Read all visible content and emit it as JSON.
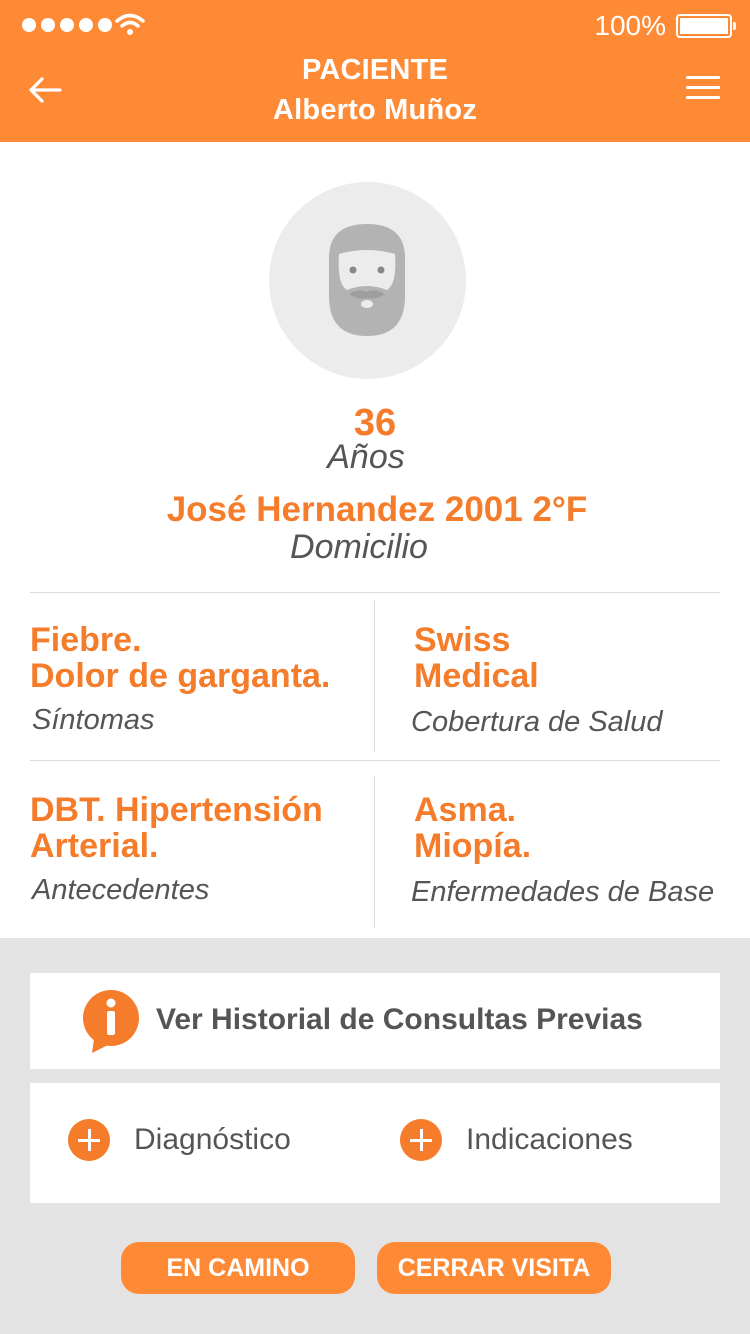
{
  "status_bar": {
    "battery": "100%",
    "signal_dots": 5
  },
  "header": {
    "title": "PACIENTE",
    "patient_name": "Alberto Muñoz"
  },
  "profile": {
    "age": "36",
    "age_label": "Años",
    "address": "José Hernandez 2001 2°F",
    "address_label": "Domicilio"
  },
  "details": {
    "sintomas": {
      "value": "Fiebre.\nDolor de garganta.",
      "label": "Síntomas"
    },
    "cobertura": {
      "value": "Swiss\nMedical",
      "label": "Cobertura de Salud"
    },
    "antecedentes": {
      "value": "DBT. Hipertensión\nArterial.",
      "label": "Antecedentes"
    },
    "enfermedades": {
      "value": "Asma.\nMiopía.",
      "label": "Enfermedades de Base"
    }
  },
  "actions": {
    "historial": "Ver Historial de Consultas Previas",
    "diagnostico": "Diagnóstico",
    "indicaciones": "Indicaciones"
  },
  "buttons": {
    "en_camino": "EN CAMINO",
    "cerrar_visita": "CERRAR VISITA"
  },
  "colors": {
    "accent": "#ff8a35",
    "accent_text": "#f47c2a",
    "muted_text": "#555555",
    "background": "#e3e3e3"
  }
}
